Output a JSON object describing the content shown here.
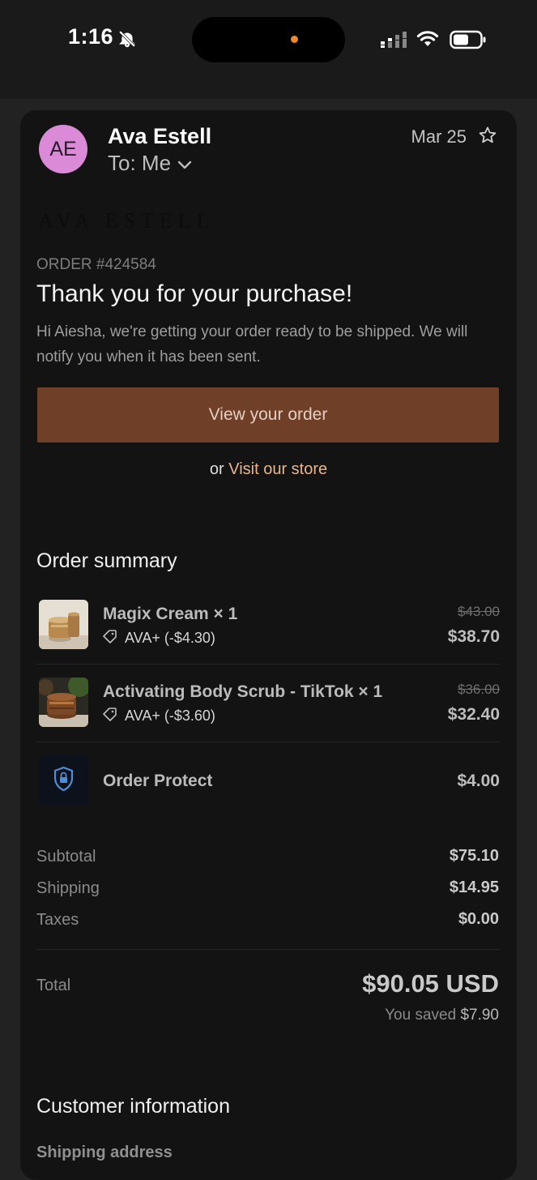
{
  "status_bar": {
    "time": "1:16"
  },
  "email": {
    "avatar_initials": "AE",
    "sender": "Ava Estell",
    "recipient": "To: Me",
    "date": "Mar 25"
  },
  "brand_logo": "AVA ESTELL",
  "order_number": "ORDER #424584",
  "heading": "Thank you for your purchase!",
  "intro": "Hi Aiesha, we're getting your order ready to be shipped. We will notify you when it has been sent.",
  "actions": {
    "view_order": "View your order",
    "or_text": "or",
    "visit_store": "Visit our store"
  },
  "order_summary": {
    "title": "Order summary",
    "items": [
      {
        "name": "Magix Cream × 1",
        "discount": "AVA+ (-$4.30)",
        "original_price": "$43.00",
        "price": "$38.70"
      },
      {
        "name": "Activating Body Scrub - TikTok × 1",
        "discount": "AVA+ (-$3.60)",
        "original_price": "$36.00",
        "price": "$32.40"
      },
      {
        "name": "Order Protect",
        "price": "$4.00"
      }
    ]
  },
  "totals": {
    "subtotal_label": "Subtotal",
    "subtotal": "$75.10",
    "shipping_label": "Shipping",
    "shipping": "$14.95",
    "taxes_label": "Taxes",
    "taxes": "$0.00",
    "total_label": "Total",
    "total": "$90.05 USD",
    "saved_prefix": "You saved",
    "saved_amount": "$7.90"
  },
  "customer_info": {
    "title": "Customer information",
    "shipping_address_label": "Shipping address"
  },
  "colors": {
    "button_bg": "#6f3f27",
    "link": "#e9b48d",
    "avatar_bg": "#da8ad6"
  }
}
